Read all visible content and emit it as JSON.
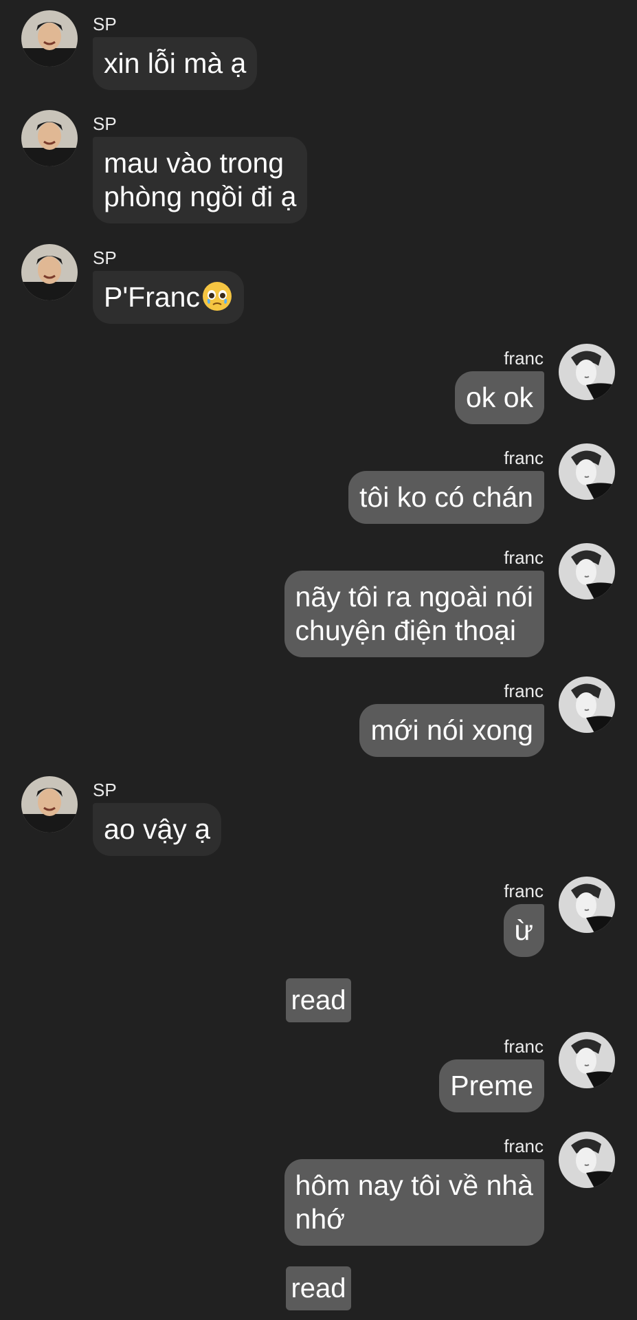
{
  "participants": {
    "other": {
      "name": "SP",
      "avatar": "person-smiling-photo"
    },
    "self": {
      "name": "franc",
      "avatar": "person-profile-bw-photo"
    }
  },
  "messages": [
    {
      "sender": "SP",
      "text": "xin lỗi mà ạ"
    },
    {
      "sender": "SP",
      "text": "mau vào trong phòng ngồi đi ạ",
      "lines": [
        "mau vào trong",
        "phòng ngồi đi ạ"
      ]
    },
    {
      "sender": "SP",
      "text": "P'Franc",
      "emoji": "pleading-face-emoji"
    },
    {
      "sender": "franc",
      "text": "ok ok"
    },
    {
      "sender": "franc",
      "text": "tôi ko có chán"
    },
    {
      "sender": "franc",
      "text": "nãy tôi ra ngoài nói chuyện điện thoại",
      "lines": [
        "nãy tôi ra ngoài nói",
        "chuyện điện thoại"
      ]
    },
    {
      "sender": "franc",
      "text": "mới nói xong"
    },
    {
      "sender": "SP",
      "text": "ao vậy ạ"
    },
    {
      "sender": "franc",
      "text": "ừ"
    },
    {
      "read_label": "read"
    },
    {
      "sender": "franc",
      "text": "Preme"
    },
    {
      "sender": "franc",
      "text": "hôm nay tôi về nhà nhớ",
      "lines": [
        "hôm nay tôi về nhà",
        "nhớ"
      ]
    },
    {
      "read_label": "read"
    }
  ],
  "colors": {
    "background": "#212121",
    "incoming_bubble": "#2e2e2e",
    "outgoing_bubble": "#5b5b5b",
    "text": "#ffffff"
  }
}
